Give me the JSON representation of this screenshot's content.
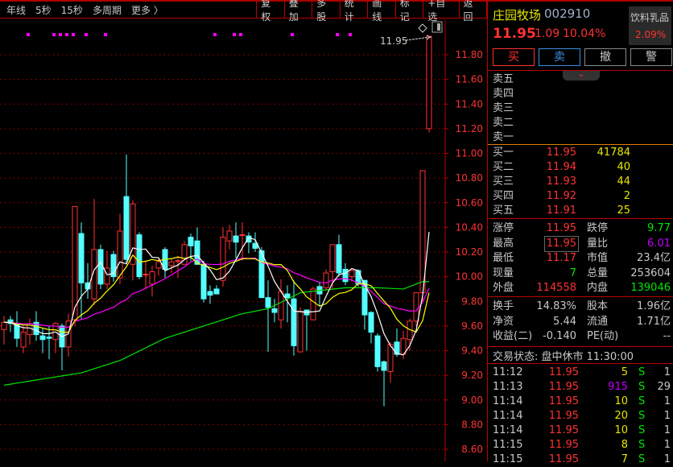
{
  "toolbar": {
    "periods": [
      "年线",
      "5秒",
      "15秒",
      "多周期",
      "更多 〉"
    ],
    "buttons": [
      "复权",
      "叠加",
      "多股",
      "统计",
      "画线",
      "标记",
      "+自选",
      "返回"
    ]
  },
  "chart_data": {
    "type": "candlestick",
    "y_ticks": [
      "11.80",
      "11.60",
      "11.40",
      "11.20",
      "11.00",
      "10.80",
      "10.60",
      "10.40",
      "10.20",
      "10.00",
      "9.80",
      "9.60",
      "9.40",
      "9.20",
      "9.00",
      "8.80",
      "8.60"
    ],
    "ylim": [
      8.6,
      11.8
    ],
    "grid": true,
    "last_price_label": "11.95",
    "up_color": "#ff3232",
    "down_color": "#54ffff",
    "ma_colors": {
      "ma5": "#ffffff",
      "ma10": "#ffff00",
      "ma20": "#ff00ff",
      "ma60": "#00e600"
    },
    "ma60_points": [
      [
        0,
        9.12
      ],
      [
        12,
        9.22
      ],
      [
        18,
        9.32
      ],
      [
        25,
        9.5
      ],
      [
        31,
        9.6
      ],
      [
        37,
        9.7
      ],
      [
        41,
        9.74
      ],
      [
        46,
        9.87
      ],
      [
        53,
        9.91
      ],
      [
        58,
        9.91
      ],
      [
        62,
        9.9
      ],
      [
        64,
        9.94
      ],
      [
        65,
        9.96
      ]
    ],
    "marker_color": "#ff00ff",
    "marker_indices": [
      2,
      6,
      7,
      8,
      9,
      11,
      14,
      31,
      34,
      35,
      43,
      50,
      52
    ],
    "candles": [
      [
        9.57,
        9.68,
        9.45,
        9.63
      ],
      [
        9.65,
        9.68,
        9.55,
        9.62
      ],
      [
        9.62,
        9.72,
        9.43,
        9.5
      ],
      [
        9.43,
        9.6,
        9.38,
        9.55
      ],
      [
        9.53,
        9.66,
        9.45,
        9.62
      ],
      [
        9.63,
        9.72,
        9.48,
        9.53
      ],
      [
        9.52,
        9.58,
        9.38,
        9.49
      ],
      [
        9.51,
        9.6,
        9.33,
        9.5
      ],
      [
        9.49,
        9.63,
        9.38,
        9.62
      ],
      [
        9.6,
        9.62,
        9.24,
        9.43
      ],
      [
        9.43,
        9.7,
        9.35,
        9.64
      ],
      [
        9.65,
        10.57,
        9.6,
        10.57
      ],
      [
        10.35,
        10.44,
        9.66,
        9.95
      ],
      [
        9.95,
        10.11,
        9.82,
        9.9
      ],
      [
        9.82,
        10.63,
        9.77,
        10.22
      ],
      [
        10.22,
        10.26,
        9.9,
        9.94
      ],
      [
        9.94,
        10.21,
        9.9,
        10.07
      ],
      [
        10.18,
        10.21,
        9.96,
        10.0
      ],
      [
        9.99,
        10.51,
        9.94,
        10.37
      ],
      [
        10.65,
        10.99,
        10.1,
        10.14
      ],
      [
        10.1,
        10.62,
        9.97,
        10.59
      ],
      [
        10.34,
        10.36,
        9.98,
        10.0
      ],
      [
        10.02,
        10.13,
        9.9,
        10.02
      ],
      [
        9.94,
        10.09,
        9.84,
        10.04
      ],
      [
        10.07,
        10.15,
        10.01,
        10.12
      ],
      [
        10.22,
        10.24,
        9.99,
        10.06
      ],
      [
        10.09,
        10.15,
        10.03,
        10.12
      ],
      [
        10.13,
        10.17,
        9.99,
        10.13
      ],
      [
        10.1,
        10.29,
        10.1,
        10.26
      ],
      [
        10.32,
        10.35,
        10.13,
        10.25
      ],
      [
        10.29,
        10.4,
        10.1,
        10.1
      ],
      [
        10.1,
        10.13,
        9.79,
        9.82
      ],
      [
        9.88,
        9.93,
        9.78,
        9.85
      ],
      [
        9.9,
        9.93,
        9.86,
        9.86
      ],
      [
        9.97,
        10.4,
        9.92,
        10.32
      ],
      [
        10.29,
        10.42,
        10.22,
        10.37
      ],
      [
        10.33,
        10.44,
        10.15,
        10.28
      ],
      [
        10.34,
        10.44,
        10.13,
        10.34
      ],
      [
        10.33,
        10.36,
        10.19,
        10.28
      ],
      [
        10.27,
        10.36,
        10.2,
        10.23
      ],
      [
        10.21,
        10.24,
        9.83,
        9.83
      ],
      [
        9.83,
        9.97,
        9.39,
        9.75
      ],
      [
        9.74,
        9.82,
        9.63,
        9.71
      ],
      [
        9.65,
        9.98,
        9.58,
        9.88
      ],
      [
        9.86,
        9.93,
        9.63,
        9.83
      ],
      [
        9.82,
        9.97,
        9.36,
        9.44
      ],
      [
        9.39,
        9.75,
        9.39,
        9.72
      ],
      [
        9.73,
        9.73,
        9.4,
        9.69
      ],
      [
        9.65,
        9.92,
        9.65,
        9.9
      ],
      [
        9.92,
        9.96,
        9.76,
        9.86
      ],
      [
        9.91,
        10.06,
        9.89,
        10.03
      ],
      [
        10.04,
        10.26,
        9.9,
        10.26
      ],
      [
        10.26,
        10.34,
        10.0,
        10.03
      ],
      [
        10.06,
        10.11,
        9.93,
        9.96
      ],
      [
        10.0,
        10.06,
        9.96,
        10.05
      ],
      [
        10.05,
        10.06,
        9.92,
        9.94
      ],
      [
        9.97,
        9.97,
        9.57,
        9.69
      ],
      [
        9.71,
        9.72,
        9.46,
        9.55
      ],
      [
        9.52,
        9.54,
        9.23,
        9.27
      ],
      [
        9.31,
        9.32,
        8.95,
        9.24
      ],
      [
        9.23,
        9.47,
        9.14,
        9.45
      ],
      [
        9.47,
        9.58,
        9.35,
        9.37
      ],
      [
        9.37,
        9.56,
        9.33,
        9.5
      ],
      [
        9.49,
        9.66,
        9.4,
        9.64
      ],
      [
        9.64,
        9.87,
        9.6,
        9.87
      ],
      [
        9.87,
        10.86,
        9.8,
        10.86
      ],
      [
        11.2,
        11.95,
        11.17,
        11.95
      ]
    ]
  },
  "stock": {
    "name": "庄园牧场",
    "code": "002910",
    "price": "11.95",
    "change": "1.09",
    "change_pct": "10.04%",
    "sector": "饮料乳品",
    "sector_pct": "2.09%"
  },
  "order_buttons": {
    "buy": "买",
    "sell": "卖",
    "cancel": "撤",
    "alert": "警"
  },
  "asks": [
    {
      "label": "卖五"
    },
    {
      "label": "卖四"
    },
    {
      "label": "卖三"
    },
    {
      "label": "卖二"
    },
    {
      "label": "卖一"
    }
  ],
  "bids": [
    {
      "label": "买一",
      "price": "11.95",
      "vol": "41784"
    },
    {
      "label": "买二",
      "price": "11.94",
      "vol": "40"
    },
    {
      "label": "买三",
      "price": "11.93",
      "vol": "44"
    },
    {
      "label": "买四",
      "price": "11.92",
      "vol": "2"
    },
    {
      "label": "买五",
      "price": "11.91",
      "vol": "25"
    }
  ],
  "stats": [
    {
      "l1": "涨停",
      "v1": "11.95",
      "c1": "red",
      "l2": "跌停",
      "v2": "9.77",
      "c2": "grn"
    },
    {
      "l1": "最高",
      "v1": "11.95",
      "c1": "red",
      "l2": "量比",
      "v2": "6.01",
      "c2": "mag"
    },
    {
      "l1": "最低",
      "v1": "11.17",
      "c1": "red",
      "l2": "市值",
      "v2": "23.4亿",
      "c2": "gry"
    },
    {
      "l1": "现量",
      "v1": "7",
      "c1": "grn",
      "l2": "总量",
      "v2": "253604",
      "c2": "gry"
    },
    {
      "l1": "外盘",
      "v1": "114558",
      "c1": "red",
      "l2": "内盘",
      "v2": "139046",
      "c2": "grn"
    }
  ],
  "fundamentals": [
    {
      "l1": "换手",
      "v1": "14.83%",
      "l2": "股本",
      "v2": "1.96亿"
    },
    {
      "l1": "净资",
      "v1": "5.44",
      "l2": "流通",
      "v2": "1.71亿"
    },
    {
      "l1": "收益(二)",
      "v1": "-0.140",
      "l2": "PE(动)",
      "v2": "--"
    }
  ],
  "trade_status": "交易状态: 盘中休市 11:30:00",
  "ticks": [
    {
      "time": "11:12",
      "price": "11.95",
      "vol": "5",
      "side": "S",
      "num": "1",
      "vc": "yel"
    },
    {
      "time": "11:13",
      "price": "11.95",
      "vol": "915",
      "side": "S",
      "num": "29",
      "vc": "mag"
    },
    {
      "time": "11:14",
      "price": "11.95",
      "vol": "10",
      "side": "S",
      "num": "1",
      "vc": "yel"
    },
    {
      "time": "11:14",
      "price": "11.95",
      "vol": "20",
      "side": "S",
      "num": "1",
      "vc": "yel"
    },
    {
      "time": "11:14",
      "price": "11.95",
      "vol": "10",
      "side": "S",
      "num": "1",
      "vc": "yel"
    },
    {
      "time": "11:15",
      "price": "11.95",
      "vol": "8",
      "side": "S",
      "num": "1",
      "vc": "yel"
    },
    {
      "time": "11:15",
      "price": "11.95",
      "vol": "7",
      "side": "S",
      "num": "1",
      "vc": "yel"
    }
  ]
}
